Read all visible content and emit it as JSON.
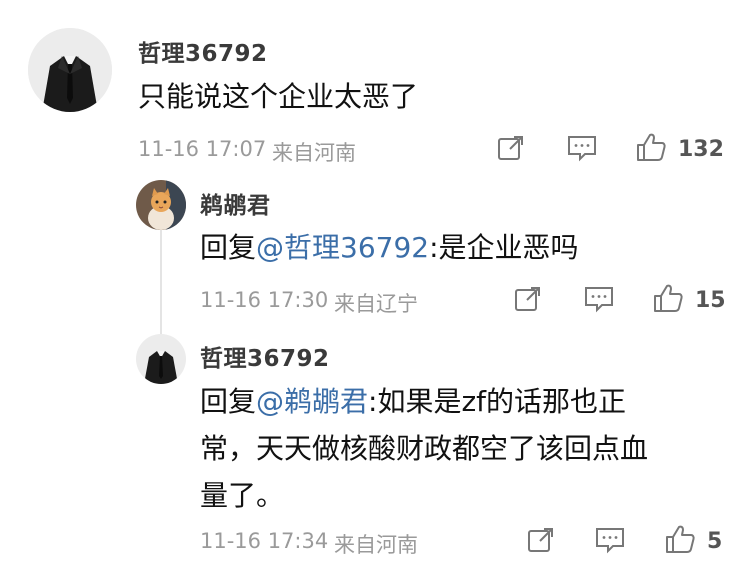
{
  "comment": {
    "username": "哲理36792",
    "text": "只能说这个企业太恶了",
    "time": "11-16 17:07",
    "location": "来自河南",
    "likes": "132",
    "icons": [
      "share-icon",
      "reply-icon",
      "like-icon"
    ]
  },
  "replies": [
    {
      "username": "鹈鹕君",
      "prefix": "回复",
      "mention": "@哲理36792",
      "text": ":是企业恶吗",
      "time": "11-16 17:30",
      "location": "来自辽宁",
      "likes": "15"
    },
    {
      "username": "哲理36792",
      "prefix": "回复",
      "mention": "@鹈鹕君",
      "text_line1": ":如果是zf的话那也正",
      "text_line2": "常，天天做核酸财政都空了该回点血",
      "text_line3": "量了。",
      "time": "11-16 17:34",
      "location": "来自河南",
      "likes": "5"
    }
  ]
}
